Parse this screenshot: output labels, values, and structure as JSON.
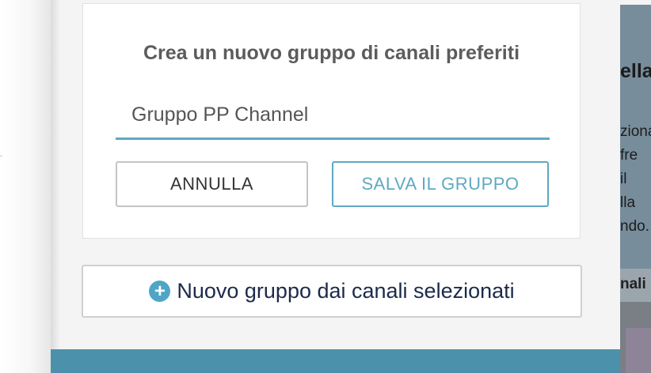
{
  "dialog": {
    "title": "Crea un nuovo gruppo di canali preferiti",
    "group_name_value": "Gruppo PP Channel",
    "cancel_label": "ANNULLA",
    "save_label": "SALVA IL GRUPPO"
  },
  "new_group": {
    "icon": "plus-circle-icon",
    "label": "Nuovo gruppo dai canali selezionati"
  },
  "background": {
    "heading_fragment": "ella",
    "lines": [
      "ziona",
      "fre",
      "il",
      "lla",
      "ndo."
    ],
    "strip_label": "nali"
  },
  "colors": {
    "accent": "#5ea9c2",
    "plus_icon": "#4ea6c6",
    "bottom_bar": "#4c91ab",
    "title_text": "#5c5c5c"
  }
}
